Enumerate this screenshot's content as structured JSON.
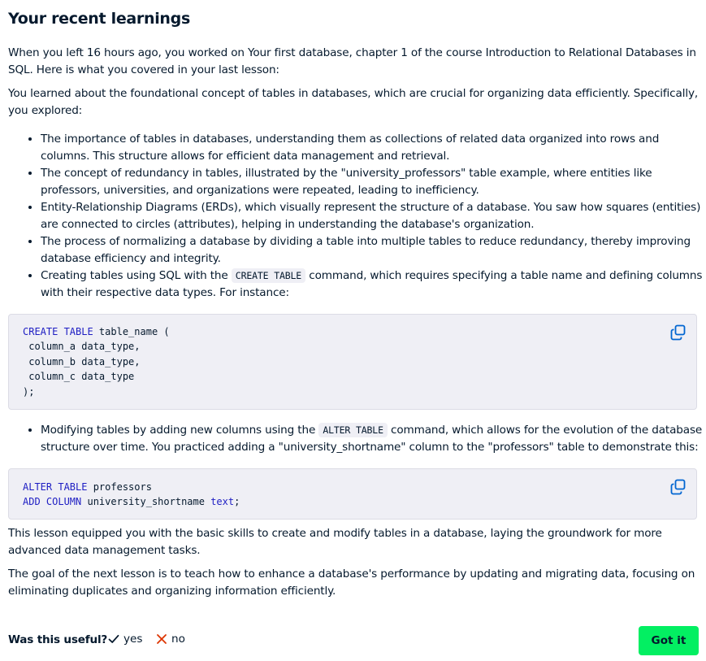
{
  "heading": "Your recent learnings",
  "intro": "When you left 16 hours ago, you worked on Your first database, chapter 1 of the course Introduction to Relational Databases in SQL. Here is what you covered in your last lesson:",
  "summary": "You learned about the foundational concept of tables in databases, which are crucial for organizing data efficiently. Specifically, you explored:",
  "bullets": [
    "The importance of tables in databases, understanding them as collections of related data organized into rows and columns. This structure allows for efficient data management and retrieval.",
    "The concept of redundancy in tables, illustrated by the \"university_professors\" table example, where entities like professors, universities, and organizations were repeated, leading to inefficiency.",
    "Entity-Relationship Diagrams (ERDs), which visually represent the structure of a database. You saw how squares (entities) are connected to circles (attributes), helping in understanding the database's organization.",
    "The process of normalizing a database by dividing a table into multiple tables to reduce redundancy, thereby improving database efficiency and integrity."
  ],
  "bullet5": {
    "before": "Creating tables using SQL with the ",
    "code": "CREATE TABLE",
    "after": " command, which requires specifying a table name and defining columns with their respective data types. For instance:"
  },
  "code1": {
    "kw": "CREATE TABLE",
    "line1_rest": " table_name (",
    "line2": " column_a data_type,",
    "line3": " column_b data_type,",
    "line4": " column_c data_type",
    "line5": ");"
  },
  "bullet6": {
    "before": "Modifying tables by adding new columns using the ",
    "code": "ALTER TABLE",
    "after": " command, which allows for the evolution of the database structure over time. You practiced adding a \"university_shortname\" column to the \"professors\" table to demonstrate this:"
  },
  "code2": {
    "kw1": "ALTER TABLE",
    "line1_rest": " professors",
    "kw2": "ADD COLUMN",
    "line2_mid": " university_shortname ",
    "kw3": "text",
    "line2_end": ";"
  },
  "closing": "This lesson equipped you with the basic skills to create and modify tables in a database, laying the groundwork for more advanced data management tasks.",
  "next_goal": "The goal of the next lesson is to teach how to enhance a database's performance by updating and migrating data, focusing on eliminating duplicates and organizing information efficiently.",
  "footer": {
    "question": "Was this useful?",
    "yes": "yes",
    "no": "no",
    "button": "Got it"
  },
  "colors": {
    "text": "#05192d",
    "keyword": "#1e1ec3",
    "code_bg": "#efeff5",
    "accent_green": "#03ef62",
    "icon_blue": "#0065d1",
    "no_red": "#dd3400"
  },
  "icons": {
    "copy": "copy-icon",
    "yes": "check-icon",
    "no": "cross-icon"
  }
}
